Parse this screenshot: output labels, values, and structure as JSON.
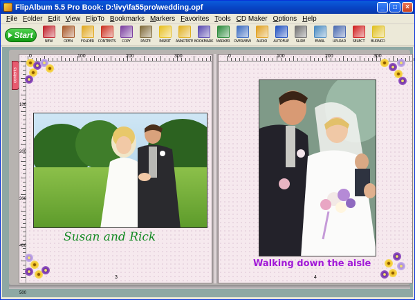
{
  "window": {
    "title": "FlipAlbum 5.5 Pro   Book: D:\\ivy\\fa55pro\\wedding.opf",
    "minimize": "_",
    "maximize": "□",
    "close": "×"
  },
  "menu": [
    "File",
    "Folder",
    "Edit",
    "View",
    "FlipTo",
    "Bookmarks",
    "Markers",
    "Favorites",
    "Tools",
    "CD Maker",
    "Options",
    "Help"
  ],
  "toolbar": {
    "start_label": "Start",
    "tools": [
      {
        "label": "NEW",
        "icon": "new-book-icon",
        "color": "#c0212a"
      },
      {
        "label": "OPEN",
        "icon": "open-book-icon",
        "color": "#a85a2a"
      },
      {
        "label": "FOLDER",
        "icon": "folder-icon",
        "color": "#e0a820"
      },
      {
        "label": "CONTENTS",
        "icon": "contents-icon",
        "color": "#cc3322"
      },
      {
        "label": "COPY",
        "icon": "copy-icon",
        "color": "#7b3fa0"
      },
      {
        "label": "PASTE",
        "icon": "paste-icon",
        "color": "#806b3a"
      },
      {
        "label": "INSERT",
        "icon": "insert-plus-icon",
        "color": "#e8c020"
      },
      {
        "label": "ANNOTATE",
        "icon": "annotate-t-icon",
        "color": "#e0b020"
      },
      {
        "label": "BOOKMARK",
        "icon": "bookmark-icon",
        "color": "#5a4ab0"
      },
      {
        "label": "MARKER",
        "icon": "marker-icon",
        "color": "#2a8a3a"
      },
      {
        "label": "OVERVIEW",
        "icon": "overview-icon",
        "color": "#3a6ac0"
      },
      {
        "label": "AUDIO",
        "icon": "audio-note-icon",
        "color": "#e0a020"
      },
      {
        "label": "AUTOFLIP",
        "icon": "autoflip-icon",
        "color": "#2050c0"
      },
      {
        "label": "SLIDE",
        "icon": "slide-icon",
        "color": "#707070"
      },
      {
        "label": "EMAIL",
        "icon": "email-icon",
        "color": "#4a8ac0"
      },
      {
        "label": "UPLOAD",
        "icon": "upload-icon",
        "color": "#4a6ab0"
      },
      {
        "label": "SELECT",
        "icon": "select-arrow-icon",
        "color": "#d02020"
      },
      {
        "label": "BURNCD",
        "icon": "burn-cd-icon",
        "color": "#e0c020"
      }
    ]
  },
  "side_tab": "contents",
  "left_page": {
    "ruler_top": [
      "0",
      "100",
      "200",
      "300"
    ],
    "ruler_side": [
      "100",
      "200",
      "300",
      "400",
      "500"
    ],
    "caption": "Susan and Rick",
    "page_number": "3"
  },
  "right_page": {
    "ruler_top": [
      "0",
      "100",
      "200",
      "300"
    ],
    "caption": "Walking down the aisle",
    "page_number": "4"
  }
}
